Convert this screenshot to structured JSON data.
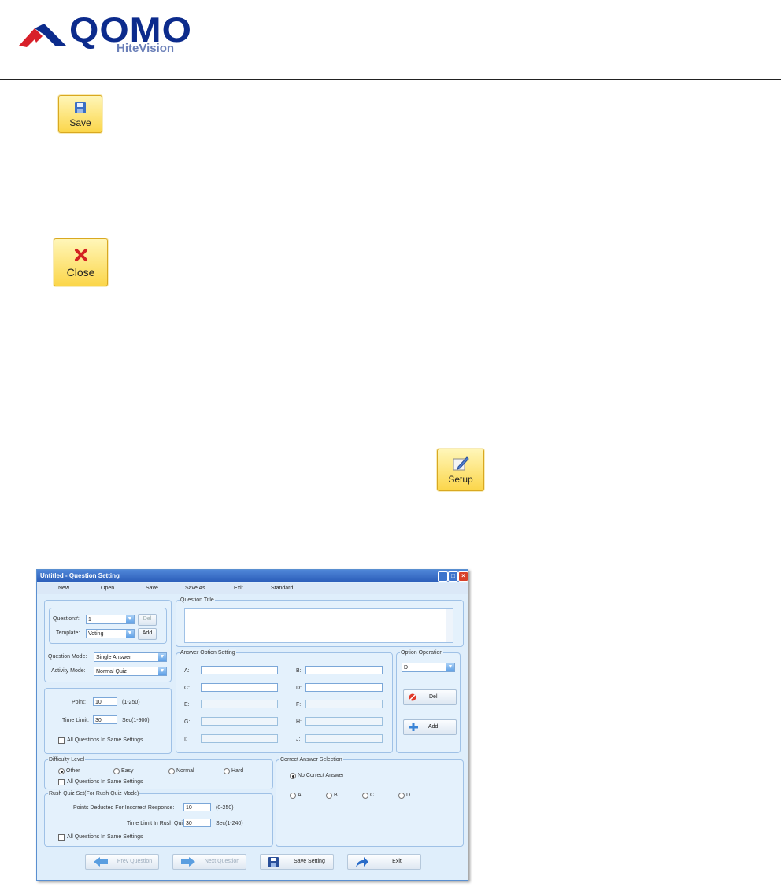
{
  "logo": {
    "text": "QOMO",
    "subtext": "HiteVision"
  },
  "buttons": {
    "save": "Save",
    "close": "Close",
    "setup": "Setup"
  },
  "window": {
    "title": "Untitled - Question Setting",
    "menu": [
      "New",
      "Open",
      "Save",
      "Save As",
      "Exit",
      "Standard"
    ],
    "question": {
      "label": "Question#:",
      "value": "1",
      "del": "Del"
    },
    "template": {
      "label": "Template:",
      "value": "Voting",
      "add": "Add"
    },
    "question_mode": {
      "label": "Question Mode:",
      "value": "Single Answer"
    },
    "activity_mode": {
      "label": "Activity Mode:",
      "value": "Normal Quiz"
    },
    "point": {
      "label": "Point:",
      "value": "10",
      "range": "(1-250)"
    },
    "time_limit": {
      "label": "Time Limit:",
      "value": "30",
      "range": "Sec(1-900)"
    },
    "same_settings": "All Questions In Same Settings",
    "question_title": {
      "legend": "Question Title"
    },
    "answer_option": {
      "legend": "Answer Option Setting",
      "letters": [
        "A:",
        "B:",
        "C:",
        "D:",
        "E:",
        "F:",
        "G:",
        "H:",
        "I:",
        "J:"
      ]
    },
    "option_operation": {
      "legend": "Option Operation",
      "value": "D",
      "del": "Del",
      "add": "Add"
    },
    "difficulty": {
      "legend": "Difficulty Level",
      "options": [
        "Other",
        "Easy",
        "Normal",
        "Hard"
      ],
      "selected": "Other"
    },
    "correct_answer": {
      "legend": "Correct Answer Selection",
      "no_correct": "No Correct Answer",
      "options": [
        "A",
        "B",
        "C",
        "D"
      ]
    },
    "rush": {
      "legend": "Rush Quiz Set(For Rush Quiz Mode)",
      "points_label": "Points Deducted For Incorrect Response:",
      "points_value": "10",
      "points_range": "(0-250)",
      "time_label": "Time Limit In Rush Quiz Mode:",
      "time_value": "30",
      "time_range": "Sec(1-240)"
    },
    "bottom": {
      "prev": "Prev Question",
      "next": "Next Question",
      "save": "Save Setting",
      "exit": "Exit"
    }
  }
}
